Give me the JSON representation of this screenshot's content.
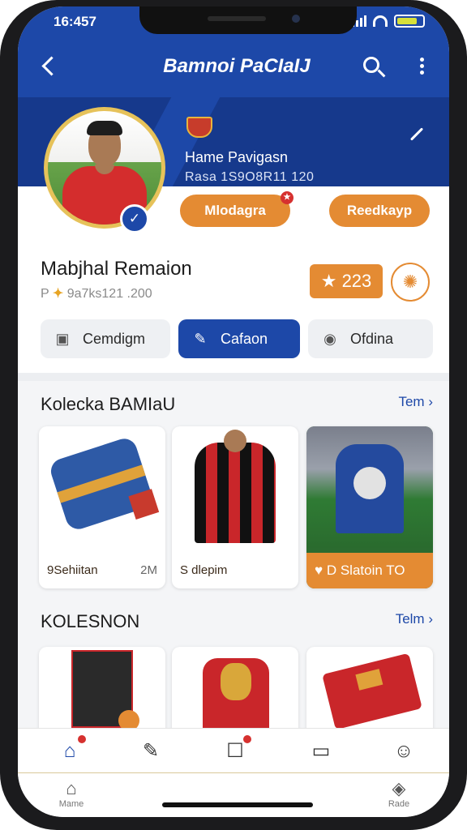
{
  "status_bar": {
    "time": "16:457"
  },
  "nav": {
    "title": "Bamnoi PaCIaIJ"
  },
  "profile": {
    "display_name": "Hame Pavigasn",
    "id_text": "Rasa 1S9O8R11 120",
    "badge_primary": "Mlodagra",
    "badge_secondary": "Reedkayp",
    "full_name": "Mabjhal  Remaion",
    "meta_prefix": "P",
    "meta_text": "9a7ks121 .200",
    "score": "223"
  },
  "actions": [
    {
      "label": "Cemdigm"
    },
    {
      "label": "Cafaon"
    },
    {
      "label": "Ofdina"
    }
  ],
  "collection": {
    "title": "Kolecka BAMIaU",
    "see_all": "Tem",
    "items": [
      {
        "caption": "9Sehiitan",
        "price": "2M"
      },
      {
        "caption": "S  dlepim",
        "price": ""
      },
      {
        "caption": "D Slatoin TO",
        "price": ""
      }
    ]
  },
  "collection2": {
    "title": "KOLESNON",
    "see_all": "Telm"
  },
  "bottom_tabs": [
    {
      "label": "Mame"
    },
    {
      "label": "Rade"
    }
  ],
  "colors": {
    "primary_blue": "#1d48a8",
    "accent_orange": "#e48b33",
    "alert_red": "#d6312f"
  }
}
